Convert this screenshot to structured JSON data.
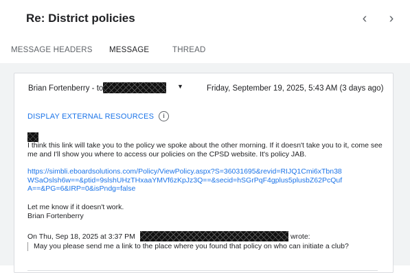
{
  "header": {
    "title": "Re: District policies",
    "prev_icon": "chevron-left-icon",
    "next_icon": "chevron-right-icon",
    "prev_glyph": "‹",
    "next_glyph": "›"
  },
  "tabs": [
    {
      "label": "MESSAGE HEADERS"
    },
    {
      "label": "MESSAGE"
    },
    {
      "label": "THREAD"
    }
  ],
  "message": {
    "sender": "Brian Fortenberry - to",
    "date": "Friday, September 19, 2025, 5:43 AM (3 days ago)",
    "expand_glyph": "▼",
    "external_resources_label": "DISPLAY EXTERNAL RESOURCES",
    "info_glyph": "i",
    "body_para1": "I think this link will take you to the policy we spoke about the other morning.  If it doesn't take you to it, come see me and I'll show you where to access our policies on the CPSD website.  It's policy JAB.",
    "link_url": "https://simbli.eboardsolutions.com/Policy/ViewPolicy.aspx?S=36031695&revid=RIJQ1Cmi6xTbn38WSaOslsh6w==&ptid=9slshUHzTHxaaYMVf6zKpJz3Q==&secid=hSGrPqF4gplus5plusbZ62PcQufA==&PG=6&IRP=0&isPndg=false",
    "body_para2": "Let me know if it doesn't work.",
    "signature": "Brian Fortenberry",
    "quote_header": "On Thu, Sep 18, 2025 at 3:37 PM",
    "quote_wrote": "wrote:",
    "quoted_text": "May you please send me a link to the place where you found that policy on who can initiate a club?"
  },
  "colors": {
    "accent": "#1a73e8",
    "background_pane": "#f1f3f4",
    "redaction": "#111111"
  }
}
